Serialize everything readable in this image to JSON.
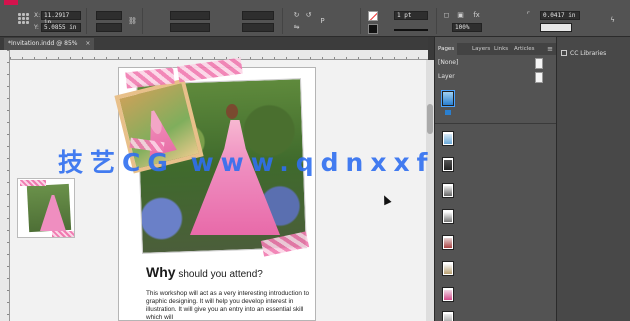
{
  "control": {
    "x_label": "X:",
    "y_label": "Y:",
    "x_value": "11.2917 in",
    "y_value": "5.0855 in",
    "stroke_weight": "1 pt",
    "zoom": "100%",
    "offset": "0.0417 in"
  },
  "document": {
    "tab_label": "*Invitation.indd @ 85%",
    "close": "×"
  },
  "panels": {
    "tabs": [
      "Pages",
      "Layers",
      "Links",
      "Articles"
    ],
    "menu_icon": "≡",
    "none_label": "[None]",
    "layer_label": "Layer",
    "dock_label": "CC Libraries"
  },
  "page": {
    "heading_big": "Why",
    "heading_rest": " should you attend?",
    "body": "This workshop will act as a very interesting introduction to graphic designing. It will help you develop interest in illustration. It will give you an entry into an essential skill which will"
  },
  "watermark": "技艺CG www.qdnxxfb.cn",
  "colors": {
    "accent": "#d4134d",
    "tape_pink": "#f07ab0",
    "watermark": "#2f6ff0"
  }
}
